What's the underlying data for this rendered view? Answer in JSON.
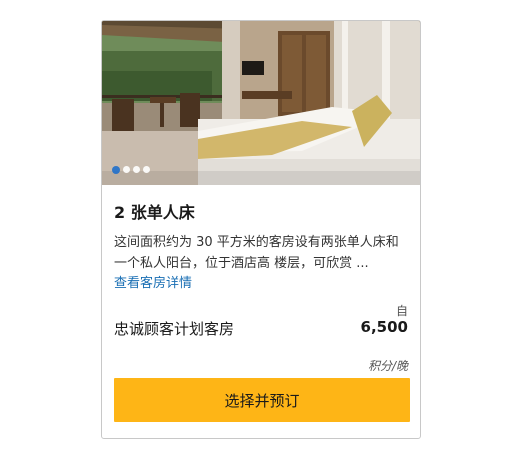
{
  "room": {
    "title": "2 张单人床",
    "description": "这间面积约为 30 平方米的客房设有两张单人床和一个私人阳台，位于酒店高 楼层，可欣赏 ...",
    "details_link": "查看客房详情"
  },
  "carousel": {
    "slide_count": 4,
    "active_index": 0,
    "accent_color": "#1f6fcb"
  },
  "pricing": {
    "from_label": "自",
    "rate_name": "忠诚顾客计划客房",
    "points": "6,500",
    "unit": "积分/晚"
  },
  "actions": {
    "book_label": "选择并预订",
    "book_color": "#feb516"
  }
}
